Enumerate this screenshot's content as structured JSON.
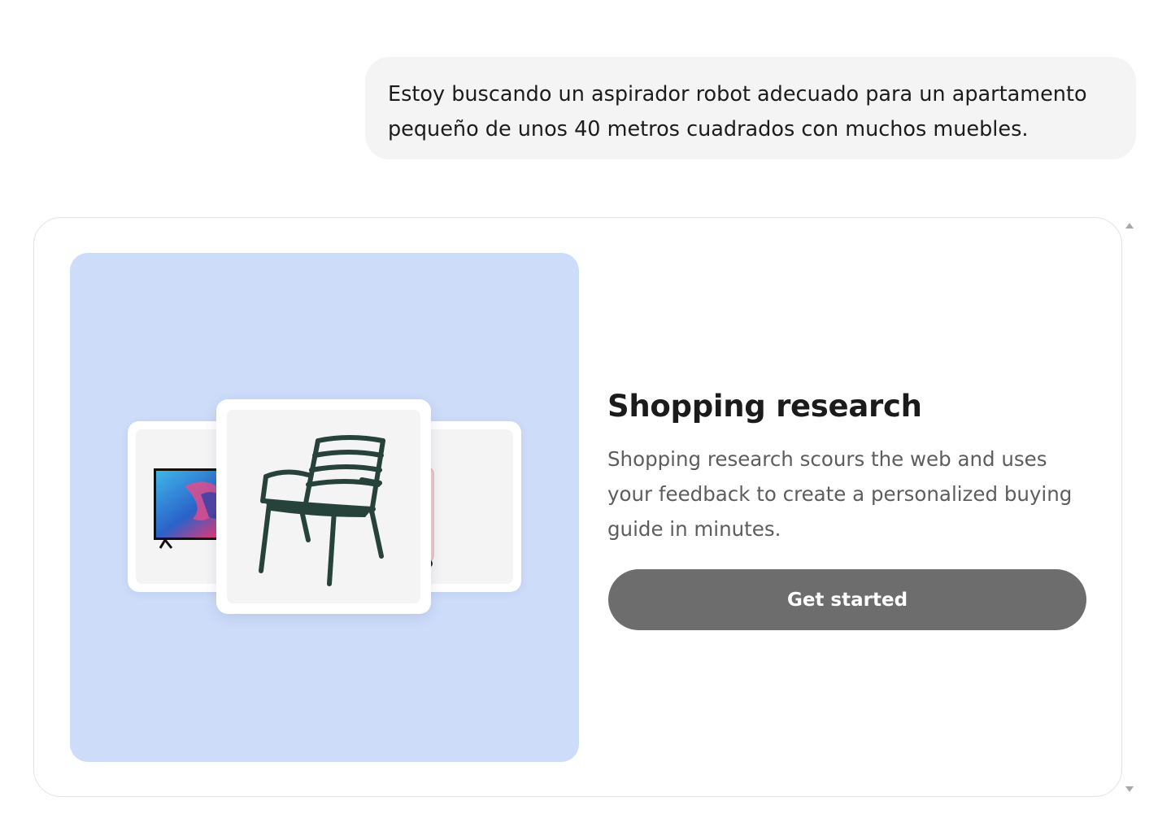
{
  "user_message": {
    "line1": "Estoy buscando un aspirador robot adecuado para un apartamento",
    "line2": "pequeño de unos 40 metros cuadrados con muchos muebles."
  },
  "shopping_card": {
    "title": "Shopping research",
    "description": "Shopping research scours the web and uses your feedback to create a personalized buying guide in minutes.",
    "button_label": "Get started",
    "hero_background": "#cddcf8",
    "button_color": "#6d6d6d",
    "products": [
      "tv-image",
      "chair-image",
      "suitcase-image"
    ]
  },
  "scrollbar": {
    "up_icon": "triangle-up-icon",
    "down_icon": "triangle-down-icon"
  }
}
